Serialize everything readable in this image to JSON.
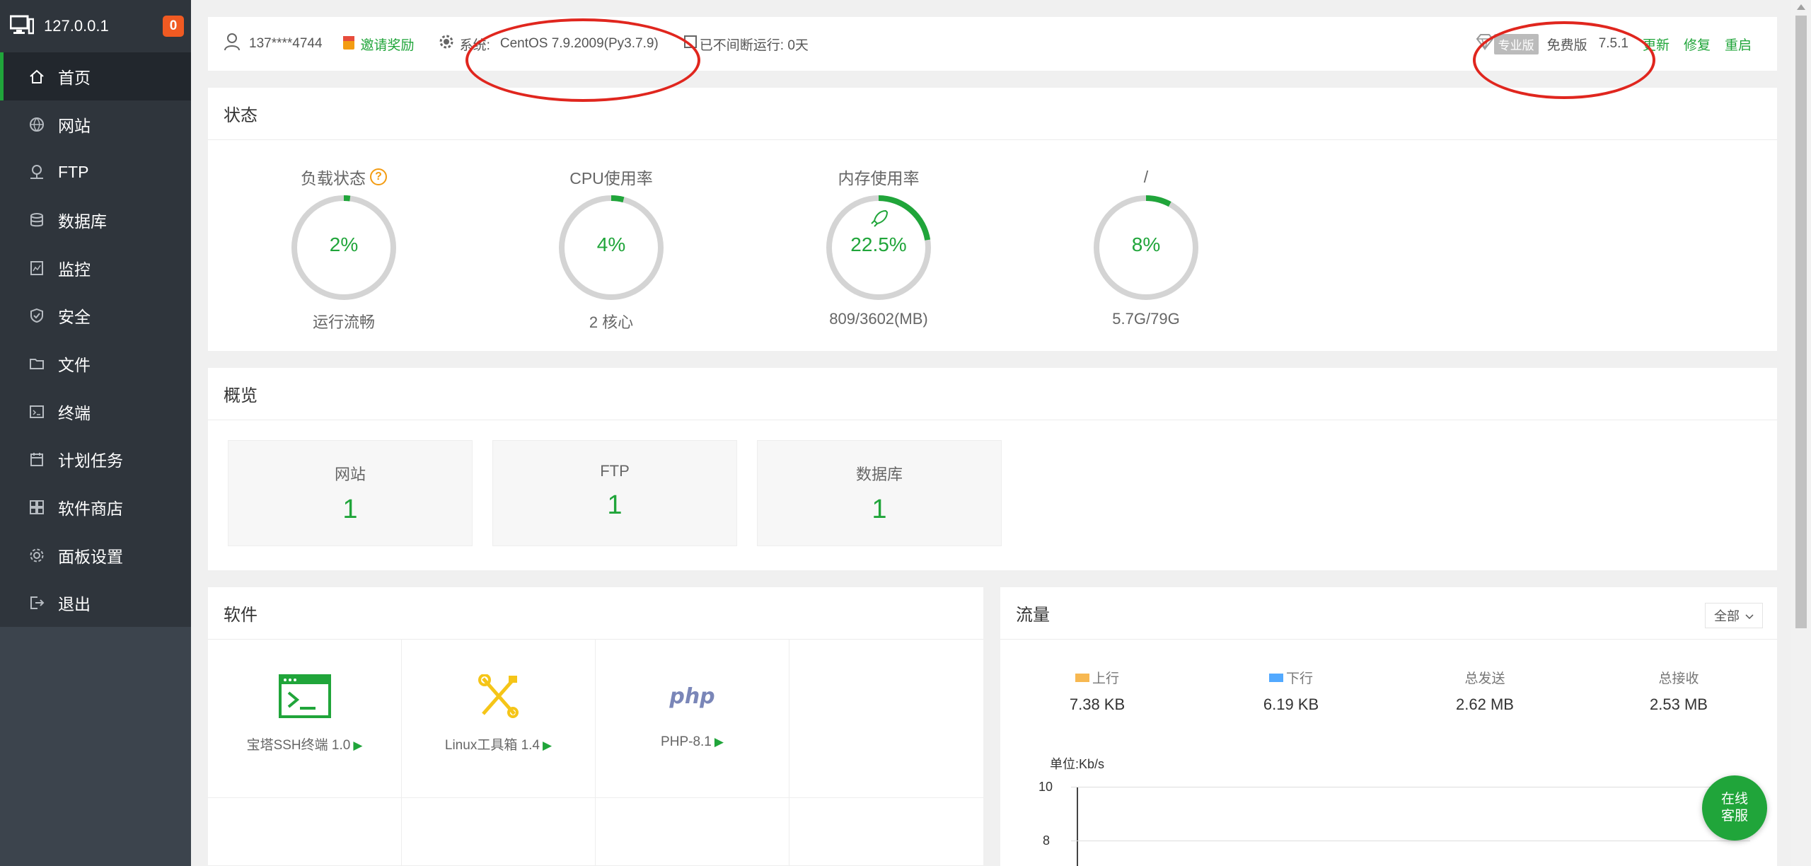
{
  "colors": {
    "accent": "#20a53a",
    "sidebar": "#3c444d",
    "badge": "#f05a22",
    "annotation": "#e0261e"
  },
  "sidebar": {
    "host": "127.0.0.1",
    "badge": "0",
    "items": [
      {
        "label": "首页",
        "icon": "home-icon"
      },
      {
        "label": "网站",
        "icon": "globe-icon"
      },
      {
        "label": "FTP",
        "icon": "ftp-icon"
      },
      {
        "label": "数据库",
        "icon": "database-icon"
      },
      {
        "label": "监控",
        "icon": "monitor-icon"
      },
      {
        "label": "安全",
        "icon": "shield-icon"
      },
      {
        "label": "文件",
        "icon": "folder-icon"
      },
      {
        "label": "终端",
        "icon": "terminal-icon"
      },
      {
        "label": "计划任务",
        "icon": "calendar-icon"
      },
      {
        "label": "软件商店",
        "icon": "apps-icon"
      },
      {
        "label": "面板设置",
        "icon": "gear-icon"
      },
      {
        "label": "退出",
        "icon": "logout-icon"
      }
    ]
  },
  "topbar": {
    "user": "137****4744",
    "invite": "邀请奖励",
    "system_label": "系统:",
    "system_value": "CentOS 7.9.2009(Py3.7.9)",
    "uptime": "已不间断运行: 0天",
    "pro_tag": "专业版",
    "edition": "免费版",
    "version": "7.5.1",
    "update": "更新",
    "repair": "修复",
    "restart": "重启"
  },
  "status": {
    "title": "状态",
    "gauges": [
      {
        "title": "负载状态",
        "value": "2%",
        "percent": 2,
        "sub": "运行流畅",
        "help": "?"
      },
      {
        "title": "CPU使用率",
        "value": "4%",
        "percent": 4,
        "sub": "2 核心"
      },
      {
        "title": "内存使用率",
        "value": "22.5%",
        "percent": 22.5,
        "sub": "809/3602(MB)"
      },
      {
        "title": "/",
        "value": "8%",
        "percent": 8,
        "sub": "5.7G/79G"
      }
    ]
  },
  "overview": {
    "title": "概览",
    "items": [
      {
        "name": "网站",
        "count": "1"
      },
      {
        "name": "FTP",
        "count": "1"
      },
      {
        "name": "数据库",
        "count": "1"
      }
    ]
  },
  "software": {
    "title": "软件",
    "items": [
      {
        "name": "宝塔SSH终端 1.0",
        "icon": "ssh-terminal-icon"
      },
      {
        "name": "Linux工具箱 1.4",
        "icon": "tools-icon"
      },
      {
        "name": "PHP-8.1",
        "icon": "php-icon",
        "icon_text": "php"
      }
    ]
  },
  "traffic": {
    "title": "流量",
    "filter": "全部",
    "stats": [
      {
        "label": "上行",
        "value": "7.38 KB",
        "color": "#f7b851"
      },
      {
        "label": "下行",
        "value": "6.19 KB",
        "color": "#52a9ff"
      },
      {
        "label": "总发送",
        "value": "2.62 MB"
      },
      {
        "label": "总接收",
        "value": "2.53 MB"
      }
    ],
    "chart_unit": "单位:Kb/s",
    "y_ticks": [
      "10",
      "8"
    ]
  },
  "support": {
    "line1": "在线",
    "line2": "客服"
  }
}
